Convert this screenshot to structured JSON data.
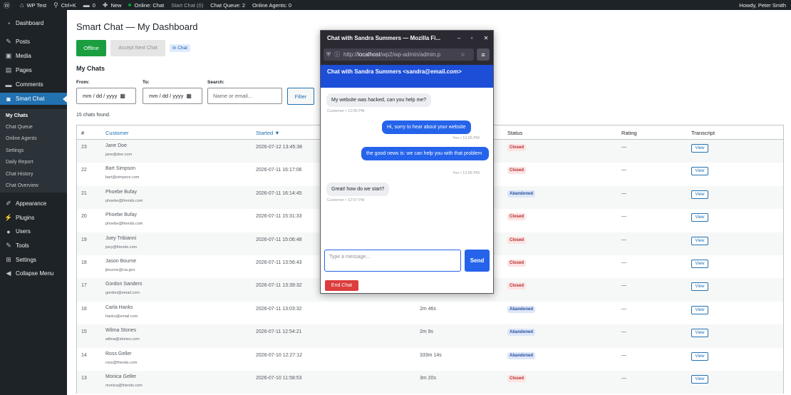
{
  "adminbar": {
    "site_name": "WP Test",
    "search_shortcut": "Ctrl+K",
    "comments_count": "0",
    "new_label": "New",
    "online_status": "Online: Chat",
    "start_chat": "Start Chat (0)",
    "chat_queue": "Chat Queue: 2",
    "online_agents": "Online Agents: 0",
    "howdy": "Howdy, Peter Smith"
  },
  "sidebar": {
    "items": [
      {
        "label": "Dashboard",
        "icon": "dashboard-icon"
      },
      {
        "label": "Posts",
        "icon": "pin-icon"
      },
      {
        "label": "Media",
        "icon": "media-icon"
      },
      {
        "label": "Pages",
        "icon": "pages-icon"
      },
      {
        "label": "Comments",
        "icon": "comment-icon"
      },
      {
        "label": "Smart Chat",
        "icon": "chat-icon"
      },
      {
        "label": "Appearance",
        "icon": "brush-icon"
      },
      {
        "label": "Plugins",
        "icon": "plug-icon"
      },
      {
        "label": "Users",
        "icon": "user-icon"
      },
      {
        "label": "Tools",
        "icon": "wrench-icon"
      },
      {
        "label": "Settings",
        "icon": "settings-icon"
      },
      {
        "label": "Collapse Menu",
        "icon": "collapse-icon"
      }
    ],
    "submenu": [
      "My Chats",
      "Chat Queue",
      "Online Agents",
      "Settings",
      "Daily Report",
      "Chat History",
      "Chat Overview"
    ]
  },
  "page": {
    "title": "Smart Chat — My Dashboard",
    "offline_button": "Offline",
    "accept_button": "Accept Next Chat",
    "in_chat_badge": "In Chat",
    "section_title": "My Chats",
    "from_label": "From:",
    "to_label": "To:",
    "search_label": "Search:",
    "date_placeholder": "mm / dd / yyyy",
    "search_placeholder": "Name or email...",
    "filter_button": "Filter",
    "chats_found": "15 chats found."
  },
  "table": {
    "headers": [
      "#",
      "Customer",
      "Started ▼",
      "Status",
      "Rating",
      "Transcript"
    ],
    "rows": [
      {
        "id": "23",
        "name": "Jane Doe",
        "email": "jane@doe.com",
        "started": "2026-07-12 13:45:38",
        "duration": "",
        "status": "Closed",
        "rating": "—",
        "view": "View"
      },
      {
        "id": "22",
        "name": "Bart Simpson",
        "email": "bart@simpson.com",
        "started": "2026-07-11 16:17:06",
        "duration": "",
        "status": "Closed",
        "rating": "—",
        "view": "View"
      },
      {
        "id": "21",
        "name": "Phoebe Bufay",
        "email": "phoebe@friends.com",
        "started": "2026-07-11 16:14:45",
        "duration": "",
        "status": "Abandoned",
        "rating": "—",
        "view": "View"
      },
      {
        "id": "20",
        "name": "Phoebe Bufay",
        "email": "phoebe@friends.com",
        "started": "2026-07-11 15:31:33",
        "duration": "",
        "status": "Closed",
        "rating": "—",
        "view": "View"
      },
      {
        "id": "19",
        "name": "Joey Tribianni",
        "email": "joey@friends.com",
        "started": "2026-07-11 15:06:48",
        "duration": "",
        "status": "Closed",
        "rating": "—",
        "view": "View"
      },
      {
        "id": "18",
        "name": "Jason Bourne",
        "email": "jbourne@cia.gov",
        "started": "2026-07-11 13:56:43",
        "duration": "",
        "status": "Closed",
        "rating": "—",
        "view": "View"
      },
      {
        "id": "17",
        "name": "Gordon Sanders",
        "email": "gordon@email.com",
        "started": "2026-07-11 13:39:32",
        "duration": "",
        "status": "Closed",
        "rating": "—",
        "view": "View"
      },
      {
        "id": "16",
        "name": "Carla Hanks",
        "email": "hanks@email.com",
        "started": "2026-07-11 13:03:32",
        "duration": "2m 46s",
        "status": "Abandoned",
        "rating": "—",
        "view": "View"
      },
      {
        "id": "15",
        "name": "Wilma Stones",
        "email": "wilma@stones.com",
        "started": "2026-07-11 12:54:21",
        "duration": "2m 9s",
        "status": "Abandoned",
        "rating": "—",
        "view": "View"
      },
      {
        "id": "14",
        "name": "Ross Geller",
        "email": "ross@friends.com",
        "started": "2026-07-10 12:27:12",
        "duration": "333m 14s",
        "status": "Abandoned",
        "rating": "—",
        "view": "View"
      },
      {
        "id": "13",
        "name": "Monica Geller",
        "email": "monica@friends.com",
        "started": "2026-07-10 11:58:53",
        "duration": "3m 20s",
        "status": "Closed",
        "rating": "—",
        "view": "View"
      }
    ]
  },
  "popup": {
    "window_title": "Chat with Sandra Summers — Mozilla Fi...",
    "url_prefix": "http://",
    "url_host": "localhost",
    "url_path": "/wp2/wp-admin/admin.p",
    "chat_title": "Chat with Sandra Summers <sandra@email.com>",
    "messages": [
      {
        "from": "them",
        "text": "My website was hacked, can you help me?",
        "meta": "Customer • 12:05 PM"
      },
      {
        "from": "me",
        "text": "Hi, sorry to hear about your website",
        "meta": "You • 12:05 PM"
      },
      {
        "from": "me",
        "text": "the good news is: we can help you with that problem",
        "meta": "You • 12:06 PM"
      },
      {
        "from": "them",
        "text": "Great! how do we start?",
        "meta": "Customer • 12:07 PM"
      }
    ],
    "input_placeholder": "Type a message...",
    "send_label": "Send",
    "end_label": "End Chat"
  },
  "colors": {
    "wp_dark": "#1d2327",
    "wp_blue": "#2271b1",
    "chat_blue": "#1d4ed8",
    "offline_green": "#1a9e40",
    "end_red": "#dc3d3d"
  }
}
